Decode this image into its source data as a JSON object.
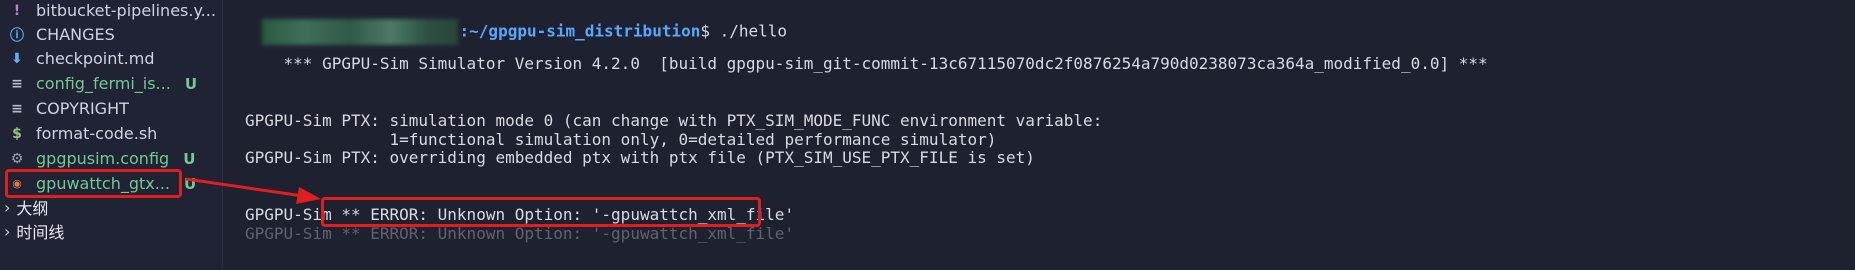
{
  "explorer": {
    "items": [
      {
        "label": "bitbucket-pipelines.y...",
        "icon": "exclamation-icon",
        "icon_glyph": "!",
        "icon_color": "#c678dd",
        "status": "",
        "modified": false
      },
      {
        "label": "CHANGES",
        "icon": "info-icon",
        "icon_glyph": "ⓘ",
        "icon_color": "#61afef",
        "status": "",
        "modified": false
      },
      {
        "label": "checkpoint.md",
        "icon": "markdown-icon",
        "icon_glyph": "⬇",
        "icon_color": "#61afef",
        "status": "",
        "modified": false
      },
      {
        "label": "config_fermi_is...",
        "icon": "file-lines-icon",
        "icon_glyph": "≡",
        "icon_color": "#b9bdc8",
        "status": "U",
        "modified": true
      },
      {
        "label": "COPYRIGHT",
        "icon": "file-lines-icon",
        "icon_glyph": "≡",
        "icon_color": "#b9bdc8",
        "status": "",
        "modified": false
      },
      {
        "label": "format-code.sh",
        "icon": "shell-dollar-icon",
        "icon_glyph": "$",
        "icon_color": "#98c379",
        "status": "",
        "modified": false
      },
      {
        "label": "gpgpusim.config",
        "icon": "gear-icon",
        "icon_glyph": "⚙",
        "icon_color": "#9aa0ad",
        "status": "U",
        "modified": true
      },
      {
        "label": "gpuwattch_gtx...",
        "icon": "rss-icon",
        "icon_glyph": "◉",
        "icon_color": "#e5733b",
        "status": "U",
        "modified": true
      }
    ],
    "sections": [
      {
        "label": "大纲"
      },
      {
        "label": "时间线"
      }
    ]
  },
  "terminal": {
    "prompt_path": ":~/gpgpu-sim_distribution",
    "prompt_rest": "$ ./hello",
    "lines": [
      "    *** GPGPU-Sim Simulator Version 4.2.0  [build gpgpu-sim_git-commit-13c67115070dc2f0876254a790d0238073ca364a_modified_0.0] ***",
      "GPGPU-Sim PTX: simulation mode 0 (can change with PTX_SIM_MODE_FUNC environment variable:",
      "               1=functional simulation only, 0=detailed performance simulator)",
      "GPGPU-Sim PTX: overriding embedded ptx with ptx file (PTX_SIM_USE_PTX_FILE is set)",
      "GPGPU-Sim ** ERROR: Unknown Option: '-gpuwattch_xml_file'",
      "GPGPU-Sim ** ERROR: Unknown Option: '-gpuwattch_xml_file'"
    ]
  },
  "colors": {
    "highlight": "#e01e1e",
    "path": "#5aa7ff",
    "modified": "#74c991"
  }
}
